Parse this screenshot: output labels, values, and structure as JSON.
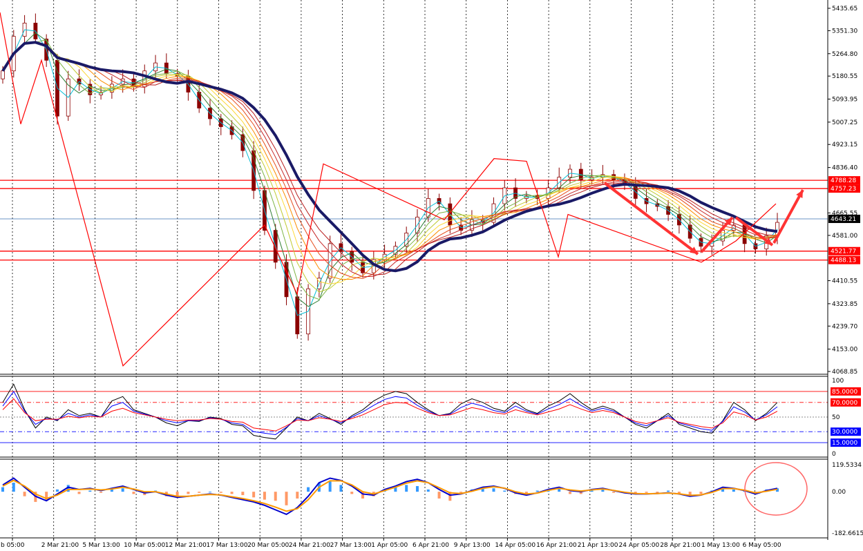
{
  "chart_data": [
    {
      "type": "candlestick",
      "panel": "price",
      "y_ticks": [
        "5435.65",
        "5351.30",
        "5264.80",
        "5180.55",
        "5093.95",
        "5007.25",
        "4923.15",
        "4836.40",
        "4665.55",
        "4581.00",
        "4410.55",
        "4323.85",
        "4239.70",
        "4153.00",
        "4068.85"
      ],
      "ylim": [
        4068.85,
        5435.65
      ],
      "levels": [
        {
          "label": "4788.28",
          "value": 4788.28,
          "color": "#ff0000"
        },
        {
          "label": "4757.23",
          "value": 4757.23,
          "color": "#ff0000"
        },
        {
          "label": "4521.77",
          "value": 4521.77,
          "color": "#ff0000"
        },
        {
          "label": "4488.13",
          "value": 4488.13,
          "color": "#ff0000"
        }
      ],
      "current_price": {
        "label": "4643.21",
        "value": 4643.21,
        "color": "#000000"
      },
      "zigzag": [
        5420,
        5000,
        5240,
        4090,
        4620,
        4360,
        4850,
        4640,
        4870,
        4860,
        4500,
        4660,
        4480,
        4560,
        4700
      ],
      "close": [
        5200,
        5330,
        5380,
        5320,
        5240,
        5030,
        5170,
        5150,
        5110,
        5120,
        5150,
        5170,
        5140,
        5200,
        5230,
        5190,
        5180,
        5120,
        5060,
        5020,
        4990,
        4960,
        4900,
        4750,
        4600,
        4480,
        4350,
        4210,
        4380,
        4420,
        4550,
        4520,
        4480,
        4440,
        4490,
        4510,
        4540,
        4590,
        4650,
        4720,
        4700,
        4620,
        4600,
        4640,
        4630,
        4700,
        4760,
        4720,
        4730,
        4720,
        4760,
        4800,
        4830,
        4790,
        4800,
        4810,
        4790,
        4770,
        4720,
        4700,
        4690,
        4660,
        4620,
        4570,
        4540,
        4560,
        4600,
        4620,
        4550,
        4530,
        4580,
        4630
      ]
    },
    {
      "type": "line",
      "panel": "oscillator",
      "y_ticks": [
        "100",
        "50",
        "0"
      ],
      "ylim": [
        0,
        100
      ],
      "levels": [
        {
          "label": "85.0000",
          "value": 85,
          "color": "#ff0000"
        },
        {
          "label": "70.0000",
          "value": 70,
          "color": "#ff0000"
        },
        {
          "label": "30.0000",
          "value": 30,
          "color": "#0000ff"
        },
        {
          "label": "15.0000",
          "value": 15,
          "color": "#0000ff"
        }
      ],
      "series": [
        {
          "color": "#000000",
          "values": [
            70,
            95,
            60,
            35,
            50,
            45,
            60,
            52,
            55,
            50,
            72,
            78,
            60,
            55,
            50,
            42,
            38,
            45,
            44,
            50,
            48,
            40,
            38,
            25,
            22,
            20,
            35,
            50,
            45,
            55,
            48,
            40,
            52,
            60,
            72,
            80,
            85,
            82,
            70,
            60,
            52,
            55,
            68,
            75,
            70,
            62,
            58,
            70,
            60,
            55,
            65,
            72,
            82,
            70,
            60,
            65,
            60,
            50,
            40,
            35,
            45,
            55,
            40,
            35,
            30,
            28,
            45,
            70,
            60,
            45,
            55,
            70
          ]
        },
        {
          "color": "#0000ff",
          "values": [
            65,
            85,
            58,
            40,
            48,
            46,
            55,
            50,
            53,
            50,
            65,
            70,
            58,
            54,
            50,
            45,
            42,
            45,
            45,
            49,
            47,
            42,
            40,
            30,
            28,
            26,
            36,
            48,
            45,
            52,
            47,
            42,
            50,
            57,
            66,
            74,
            78,
            76,
            66,
            58,
            52,
            54,
            63,
            69,
            65,
            59,
            56,
            65,
            58,
            54,
            61,
            67,
            75,
            66,
            58,
            62,
            58,
            50,
            42,
            38,
            45,
            52,
            42,
            38,
            34,
            32,
            44,
            64,
            57,
            46,
            53,
            64
          ]
        },
        {
          "color": "#ff0000",
          "values": [
            60,
            75,
            56,
            45,
            47,
            47,
            51,
            49,
            51,
            50,
            58,
            62,
            56,
            53,
            50,
            47,
            45,
            46,
            46,
            48,
            47,
            44,
            43,
            35,
            33,
            31,
            38,
            46,
            45,
            49,
            47,
            44,
            48,
            53,
            60,
            67,
            70,
            69,
            62,
            56,
            52,
            53,
            58,
            63,
            60,
            56,
            54,
            60,
            56,
            53,
            57,
            61,
            67,
            61,
            56,
            59,
            56,
            50,
            44,
            41,
            45,
            49,
            43,
            40,
            37,
            35,
            42,
            57,
            53,
            46,
            50,
            58
          ]
        }
      ]
    },
    {
      "type": "bar",
      "panel": "macd",
      "y_ticks": [
        "119.5334",
        "0.00",
        "-182.6615"
      ],
      "ylim": [
        -182.6615,
        119.5334
      ],
      "series": [
        {
          "name": "histogram",
          "values": [
            20,
            40,
            -20,
            -45,
            -40,
            10,
            30,
            -10,
            5,
            -5,
            10,
            15,
            -10,
            -15,
            5,
            -20,
            -25,
            -10,
            -5,
            0,
            -5,
            -10,
            -15,
            -25,
            -35,
            -40,
            -60,
            -30,
            20,
            40,
            45,
            30,
            -10,
            -30,
            -20,
            10,
            20,
            30,
            25,
            10,
            -30,
            -40,
            -5,
            10,
            20,
            15,
            5,
            -10,
            -15,
            5,
            10,
            15,
            -10,
            -10,
            5,
            10,
            -5,
            -5,
            -10,
            -5,
            -5,
            5,
            -10,
            -15,
            -10,
            5,
            15,
            10,
            5,
            -5,
            10,
            15
          ]
        },
        {
          "color": "#0000cc",
          "values": [
            30,
            60,
            20,
            -20,
            -40,
            -10,
            20,
            10,
            15,
            5,
            15,
            25,
            10,
            -5,
            0,
            -15,
            -25,
            -20,
            -15,
            -10,
            -15,
            -25,
            -35,
            -45,
            -60,
            -80,
            -100,
            -70,
            -20,
            40,
            60,
            50,
            25,
            -10,
            -15,
            10,
            25,
            45,
            55,
            40,
            10,
            -15,
            -10,
            5,
            20,
            25,
            15,
            -5,
            -15,
            -5,
            10,
            20,
            5,
            0,
            10,
            15,
            5,
            -5,
            -10,
            -10,
            -8,
            -5,
            -10,
            -20,
            -15,
            0,
            20,
            15,
            5,
            -10,
            5,
            15
          ]
        },
        {
          "color": "#ff9900",
          "values": [
            25,
            50,
            25,
            -10,
            -30,
            -15,
            10,
            10,
            12,
            8,
            12,
            20,
            12,
            0,
            0,
            -10,
            -20,
            -20,
            -15,
            -12,
            -14,
            -22,
            -30,
            -40,
            -52,
            -68,
            -86,
            -75,
            -35,
            20,
            48,
            48,
            30,
            0,
            -10,
            5,
            20,
            38,
            48,
            40,
            18,
            -5,
            -8,
            2,
            15,
            22,
            16,
            0,
            -10,
            -6,
            6,
            15,
            8,
            3,
            8,
            12,
            6,
            -2,
            -8,
            -9,
            -8,
            -6,
            -9,
            -16,
            -14,
            -3,
            14,
            14,
            7,
            -5,
            2,
            11
          ]
        }
      ]
    },
    {
      "type": "axis",
      "x_ticks": [
        "b 05:00",
        "2 Mar 21:00",
        "5 Mar 13:00",
        "10 Mar 05:00",
        "12 Mar 21:00",
        "17 Mar 13:00",
        "20 Mar 05:00",
        "24 Mar 21:00",
        "27 Mar 13:00",
        "1 Apr 05:00",
        "6 Apr 21:00",
        "9 Apr 13:00",
        "14 Apr 05:00",
        "16 Apr 21:00",
        "21 Apr 13:00",
        "24 Apr 05:00",
        "28 Apr 21:00",
        "1 May 13:00",
        "6 May 05:00"
      ]
    }
  ]
}
